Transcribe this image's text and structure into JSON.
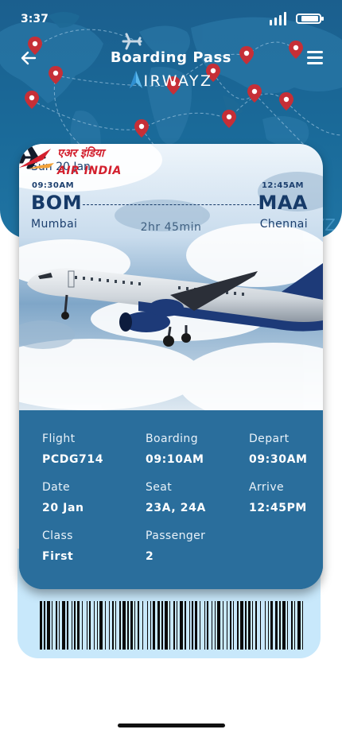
{
  "status_bar": {
    "time": "3:37"
  },
  "header": {
    "title": "Boarding Pass",
    "brand": "IRWAYZ"
  },
  "ticket": {
    "date": "Sun 20 Jan",
    "departure": {
      "time": "09:30AM",
      "code": "BOM",
      "city": "Mumbai"
    },
    "arrival": {
      "time": "12:45AM",
      "code": "MAA",
      "city": "Chennai"
    },
    "duration": "2hr 45min",
    "airline_logo_text": "AIR INDIA",
    "airline_logo_hindi": "एअर इंडिया"
  },
  "details": {
    "flight_label": "Flight",
    "flight_value": "PCDG714",
    "boarding_label": "Boarding",
    "boarding_value": "09:10AM",
    "depart_label": "Depart",
    "depart_value": "09:30AM",
    "date_label": "Date",
    "date_value": "20 Jan",
    "seat_label": "Seat",
    "seat_value": "23A, 24A",
    "arrive_label": "Arrive",
    "arrive_value": "12:45PM",
    "class_label": "Class",
    "class_value": "First",
    "passenger_label": "Passenger",
    "passenger_value": "2"
  },
  "colors": {
    "header_blue": "#1b5f8e",
    "card_blue": "#2a6e9c",
    "navy_text": "#163a68",
    "ticket_base": "#c8e8fb",
    "pin_red": "#c62f37",
    "airline_red": "#d3202e"
  },
  "icons": [
    "back-arrow-icon",
    "menu-icon",
    "airplane-icon",
    "location-pin-icon",
    "signal-icon",
    "battery-icon"
  ]
}
